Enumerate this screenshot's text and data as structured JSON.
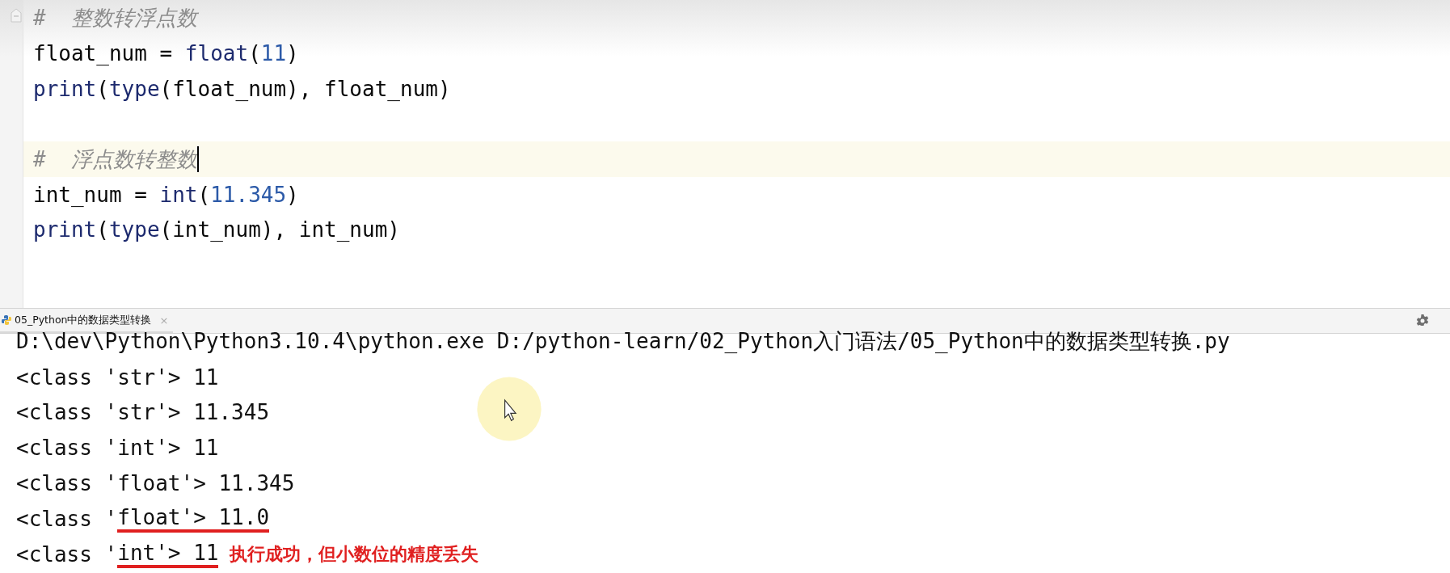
{
  "editor": {
    "lines": [
      {
        "current": false,
        "tokens": [
          {
            "kind": "comment",
            "text": "#  整数转浮点数"
          }
        ]
      },
      {
        "current": false,
        "tokens": [
          {
            "kind": "plain",
            "text": "float_num = "
          },
          {
            "kind": "builtin",
            "text": "float"
          },
          {
            "kind": "plain",
            "text": "("
          },
          {
            "kind": "number",
            "text": "11"
          },
          {
            "kind": "plain",
            "text": ")"
          }
        ]
      },
      {
        "current": false,
        "tokens": [
          {
            "kind": "builtin",
            "text": "print"
          },
          {
            "kind": "plain",
            "text": "("
          },
          {
            "kind": "builtin",
            "text": "type"
          },
          {
            "kind": "plain",
            "text": "(float_num), float_num)"
          }
        ]
      },
      {
        "current": false
      },
      {
        "current": true,
        "tokens": [
          {
            "kind": "comment",
            "text": "#  浮点数转整数"
          }
        ]
      },
      {
        "current": false,
        "tokens": [
          {
            "kind": "plain",
            "text": "int_num = "
          },
          {
            "kind": "builtin",
            "text": "int"
          },
          {
            "kind": "plain",
            "text": "("
          },
          {
            "kind": "number",
            "text": "11.345"
          },
          {
            "kind": "plain",
            "text": ")"
          }
        ]
      },
      {
        "current": false,
        "tokens": [
          {
            "kind": "builtin",
            "text": "print"
          },
          {
            "kind": "plain",
            "text": "("
          },
          {
            "kind": "builtin",
            "text": "type"
          },
          {
            "kind": "plain",
            "text": "(int_num), int_num)"
          }
        ]
      }
    ]
  },
  "run_tab": {
    "label": "05_Python中的数据类型转换",
    "close": "×"
  },
  "console": {
    "lines": [
      {
        "segments": [
          {
            "text": "D:\\dev\\Python\\Python3.10.4\\python.exe D:/python-learn/02_Python入门语法/05_Python中的数据类型转换.py",
            "underlined": false
          }
        ]
      },
      {
        "segments": [
          {
            "text": "<class 'str'> 11",
            "underlined": false
          }
        ]
      },
      {
        "segments": [
          {
            "text": "<class 'str'> 11.345",
            "underlined": false
          }
        ]
      },
      {
        "segments": [
          {
            "text": "<class 'int'> 11",
            "underlined": false
          }
        ]
      },
      {
        "segments": [
          {
            "text": "<class 'float'> 11.345",
            "underlined": false
          }
        ]
      },
      {
        "segments": [
          {
            "text": "<class '",
            "underlined": false
          },
          {
            "text": "float'> 11.0",
            "underlined": true
          }
        ]
      },
      {
        "segments": [
          {
            "text": "<class '",
            "underlined": false
          },
          {
            "text": "int'> 11",
            "underlined": true
          }
        ],
        "note": "执行成功，但小数位的精度丢失"
      }
    ]
  }
}
